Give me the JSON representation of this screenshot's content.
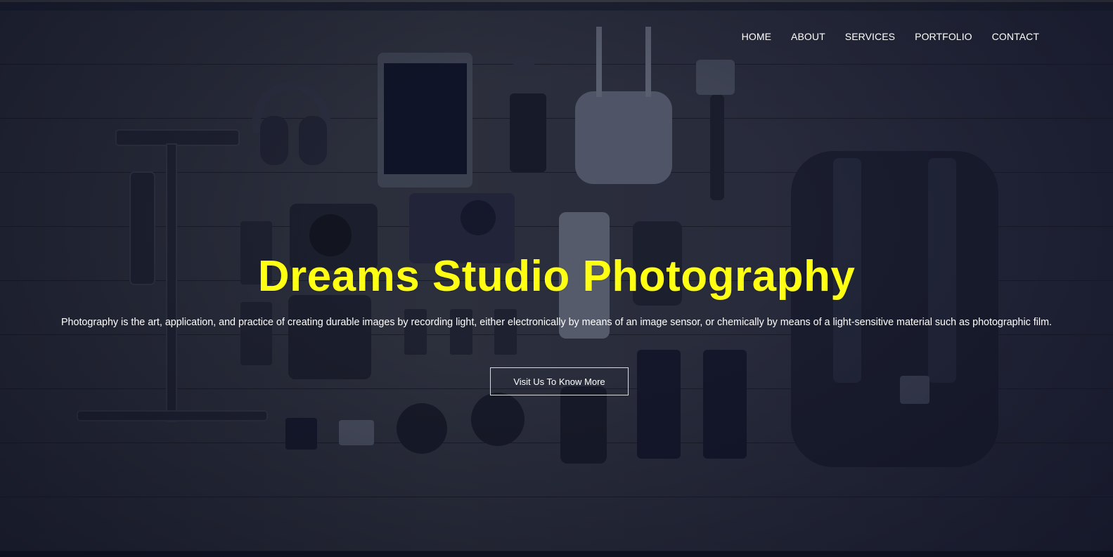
{
  "nav": {
    "items": [
      {
        "label": "HOME"
      },
      {
        "label": "ABOUT"
      },
      {
        "label": "SERVICES"
      },
      {
        "label": "PORTFOLIO"
      },
      {
        "label": "CONTACT"
      }
    ]
  },
  "hero": {
    "title": "Dreams Studio Photography",
    "description": "Photography is the art, application, and practice of creating durable images by recording light, either electronically by means of an image sensor, or chemically by means of a light-sensitive material such as photographic film.",
    "cta_label": "Visit Us To Know More",
    "background_image": "camera-gear-flatlay-background"
  },
  "colors": {
    "title": "#ffff14",
    "text": "#ffffff",
    "overlay": "#181c2a"
  }
}
